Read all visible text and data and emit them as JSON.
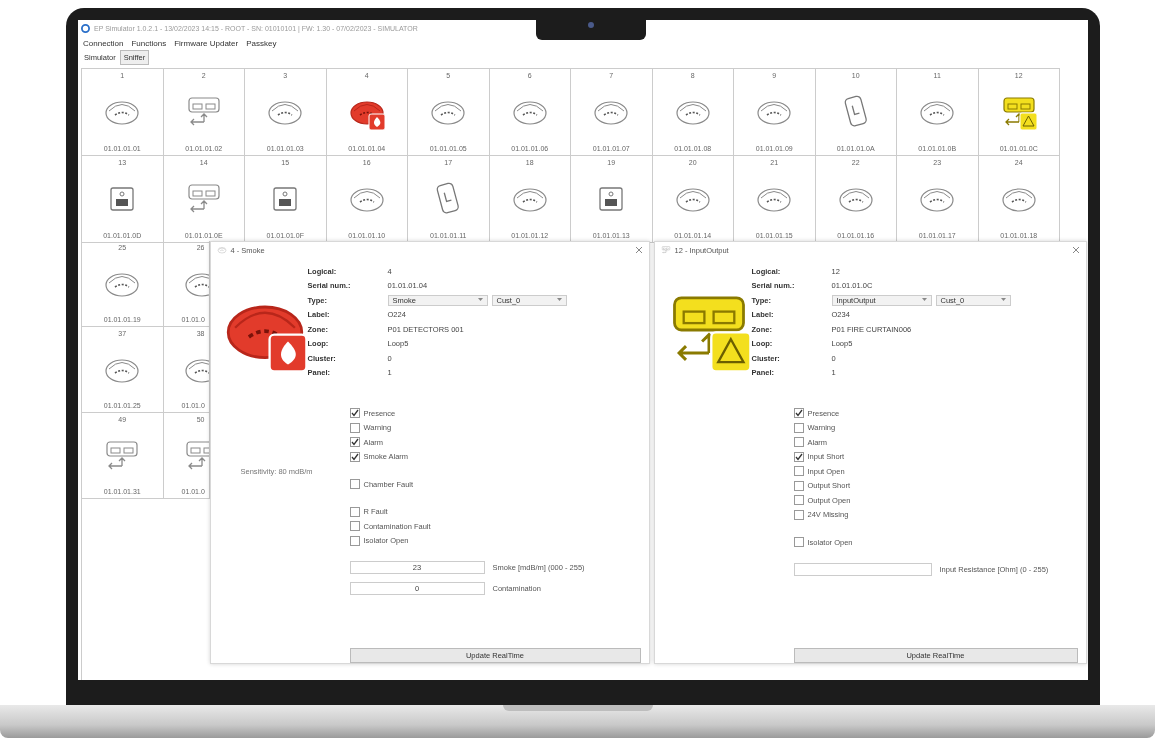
{
  "window": {
    "title": "EP Simulator 1.0.2.1 - 13/02/2023 14:15 - ROOT - SN: 01010101 | FW: 1.30 - 07/02/2023 - SIMULATOR"
  },
  "menu": [
    "Connection",
    "Functions",
    "Firmware Updater",
    "Passkey"
  ],
  "tabs": [
    {
      "label": "Simulator",
      "selected": true
    },
    {
      "label": "Sniffer",
      "selected": false
    }
  ],
  "grid_top": [
    {
      "number": "1",
      "serial": "01.01.01.01",
      "kind": "smoke",
      "alarm": false,
      "fault": false
    },
    {
      "number": "2",
      "serial": "01.01.01.02",
      "kind": "io",
      "alarm": false,
      "fault": false
    },
    {
      "number": "3",
      "serial": "01.01.01.03",
      "kind": "smoke",
      "alarm": false,
      "fault": false
    },
    {
      "number": "4",
      "serial": "01.01.01.04",
      "kind": "smoke",
      "alarm": true,
      "fault": false
    },
    {
      "number": "5",
      "serial": "01.01.01.05",
      "kind": "smoke",
      "alarm": false,
      "fault": false
    },
    {
      "number": "6",
      "serial": "01.01.01.06",
      "kind": "smoke",
      "alarm": false,
      "fault": false
    },
    {
      "number": "7",
      "serial": "01.01.01.07",
      "kind": "smoke",
      "alarm": false,
      "fault": false
    },
    {
      "number": "8",
      "serial": "01.01.01.08",
      "kind": "smoke",
      "alarm": false,
      "fault": false
    },
    {
      "number": "9",
      "serial": "01.01.01.09",
      "kind": "smoke",
      "alarm": false,
      "fault": false
    },
    {
      "number": "10",
      "serial": "01.01.01.0A",
      "kind": "wall",
      "alarm": false,
      "fault": false
    },
    {
      "number": "11",
      "serial": "01.01.01.0B",
      "kind": "smoke",
      "alarm": false,
      "fault": false
    },
    {
      "number": "12",
      "serial": "01.01.01.0C",
      "kind": "io",
      "alarm": false,
      "fault": true
    },
    {
      "number": "13",
      "serial": "01.01.01.0D",
      "kind": "box",
      "alarm": false,
      "fault": false
    },
    {
      "number": "14",
      "serial": "01.01.01.0E",
      "kind": "io",
      "alarm": false,
      "fault": false
    },
    {
      "number": "15",
      "serial": "01.01.01.0F",
      "kind": "box",
      "alarm": false,
      "fault": false
    },
    {
      "number": "16",
      "serial": "01.01.01.10",
      "kind": "smoke",
      "alarm": false,
      "fault": false
    },
    {
      "number": "17",
      "serial": "01.01.01.11",
      "kind": "wall",
      "alarm": false,
      "fault": false
    },
    {
      "number": "18",
      "serial": "01.01.01.12",
      "kind": "smoke",
      "alarm": false,
      "fault": false
    },
    {
      "number": "19",
      "serial": "01.01.01.13",
      "kind": "box",
      "alarm": false,
      "fault": false
    },
    {
      "number": "20",
      "serial": "01.01.01.14",
      "kind": "smoke",
      "alarm": false,
      "fault": false
    },
    {
      "number": "21",
      "serial": "01.01.01.15",
      "kind": "smoke",
      "alarm": false,
      "fault": false
    },
    {
      "number": "22",
      "serial": "01.01.01.16",
      "kind": "smoke",
      "alarm": false,
      "fault": false
    },
    {
      "number": "23",
      "serial": "01.01.01.17",
      "kind": "smoke",
      "alarm": false,
      "fault": false
    },
    {
      "number": "24",
      "serial": "01.01.01.18",
      "kind": "smoke",
      "alarm": false,
      "fault": false
    }
  ],
  "grid_left": [
    {
      "number": "25",
      "serial": "01.01.01.19",
      "kind": "smoke",
      "alarm": false,
      "fault": false
    },
    {
      "number": "26",
      "serial": "01.01.0",
      "kind": "smoke",
      "alarm": false,
      "fault": false
    },
    {
      "number": "37",
      "serial": "01.01.01.25",
      "kind": "smoke",
      "alarm": false,
      "fault": false
    },
    {
      "number": "38",
      "serial": "01.01.0",
      "kind": "smoke",
      "alarm": false,
      "fault": false
    },
    {
      "number": "49",
      "serial": "01.01.01.31",
      "kind": "io",
      "alarm": false,
      "fault": false
    },
    {
      "number": "50",
      "serial": "01.01.0",
      "kind": "io",
      "alarm": false,
      "fault": false
    }
  ],
  "dialogs": [
    {
      "title": "4 - Smoke",
      "kind": "smoke",
      "alarm": true,
      "fault": false,
      "fields": [
        {
          "label": "Logical:",
          "value": "4"
        },
        {
          "label": "Serial num.:",
          "value": "01.01.01.04"
        },
        {
          "label": "Type:",
          "kind": "select",
          "values": [
            "Smoke",
            "Cust_0"
          ]
        },
        {
          "label": "Label:",
          "value": "O224"
        },
        {
          "label": "Zone:",
          "value": "P01 DETECTORS 001"
        },
        {
          "label": "Loop:",
          "value": "Loop5"
        },
        {
          "label": "Cluster:",
          "value": "0"
        },
        {
          "label": "Panel:",
          "value": "1"
        }
      ],
      "check_groups": [
        {
          "items": [
            {
              "label": "Presence",
              "checked": true
            },
            {
              "label": "Warning",
              "checked": false
            },
            {
              "label": "Alarm",
              "checked": true
            },
            {
              "label": "Smoke Alarm",
              "checked": true
            }
          ]
        },
        {
          "note": "Sensitivity: 80 mdB/m",
          "items": [
            {
              "label": "Chamber Fault",
              "checked": false
            }
          ]
        },
        {
          "items": [
            {
              "label": "R Fault",
              "checked": false
            },
            {
              "label": "Contamination Fault",
              "checked": false
            },
            {
              "label": "Isolator Open",
              "checked": false
            }
          ]
        }
      ],
      "inputs": [
        {
          "value": "23",
          "label": "Smoke [mdB/m] (000 - 255)"
        },
        {
          "value": "0",
          "label": "Contamination"
        }
      ],
      "button": "Update RealTime"
    },
    {
      "title": "12 - InputOutput",
      "kind": "io",
      "alarm": false,
      "fault": true,
      "fields": [
        {
          "label": "Logical:",
          "value": "12"
        },
        {
          "label": "Serial num.:",
          "value": "01.01.01.0C"
        },
        {
          "label": "Type:",
          "kind": "select",
          "values": [
            "InputOutput",
            "Cust_0"
          ]
        },
        {
          "label": "Label:",
          "value": "O234"
        },
        {
          "label": "Zone:",
          "value": "P01 FIRE CURTAIN006"
        },
        {
          "label": "Loop:",
          "value": "Loop5"
        },
        {
          "label": "Cluster:",
          "value": "0"
        },
        {
          "label": "Panel:",
          "value": "1"
        }
      ],
      "check_groups": [
        {
          "items": [
            {
              "label": "Presence",
              "checked": true
            },
            {
              "label": "Warning",
              "checked": false
            },
            {
              "label": "Alarm",
              "checked": false
            },
            {
              "label": "Input Short",
              "checked": true
            },
            {
              "label": "Input Open",
              "checked": false
            },
            {
              "label": "Output Short",
              "checked": false
            },
            {
              "label": "Output Open",
              "checked": false
            },
            {
              "label": "24V Missing",
              "checked": false
            }
          ]
        },
        {
          "items": [
            {
              "label": "Isolator Open",
              "checked": false
            }
          ]
        }
      ],
      "inputs": [
        {
          "label": "Input Resistance [Ohm] (0 - 255)"
        }
      ],
      "button": "Update RealTime"
    }
  ]
}
